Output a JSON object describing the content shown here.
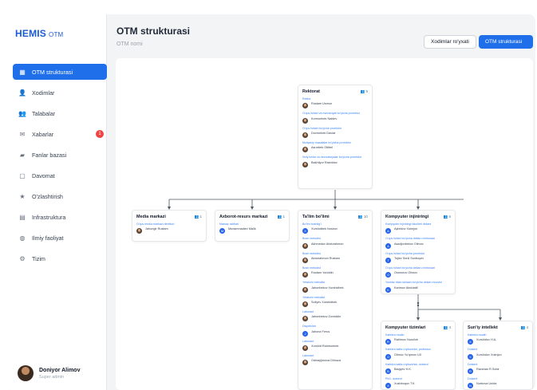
{
  "app": {
    "brand": "HEMIS",
    "brand_sub": "OTM"
  },
  "sidebar": {
    "items": [
      {
        "label": "OTM strukturasi",
        "icon": "org-chart-icon",
        "active": true
      },
      {
        "label": "Xodimlar",
        "icon": "person-icon"
      },
      {
        "label": "Talabalar",
        "icon": "group-icon"
      },
      {
        "label": "Xabarlar",
        "icon": "mail-icon",
        "badge": "1"
      },
      {
        "label": "Fanlar bazasi",
        "icon": "folder-icon"
      },
      {
        "label": "Davomat",
        "icon": "calendar-icon"
      },
      {
        "label": "O'zlashtirish",
        "icon": "star-icon"
      },
      {
        "label": "Infrastruktura",
        "icon": "building-icon"
      },
      {
        "label": "Ilmiy faoliyat",
        "icon": "globe-icon"
      },
      {
        "label": "Tizim",
        "icon": "gear-icon"
      }
    ]
  },
  "user": {
    "name": "Doniyor Alimov",
    "role": "Super admin"
  },
  "header": {
    "title": "OTM strukturasi",
    "subtitle": "OTM nomi",
    "btn_staff": "Xodimlar ro'yxati",
    "btn_structure": "OTM strukturasi"
  },
  "colors": {
    "accent": "#1f6feb",
    "badge": "#ef4444"
  },
  "org": {
    "rektorat": {
      "title": "Rektorat",
      "count": "5",
      "entries": [
        {
          "position": "Rektor",
          "name": "Rustam Usmon"
        },
        {
          "position": "O'quv ishlari va ma'naviyat bo'yicha prorektor",
          "name": "Komronbek Nabiev"
        },
        {
          "position": "O'quv ishlari bo'yicha prorektor",
          "name": "Dovronbek Davlat"
        },
        {
          "position": "Moliyaviy masalalar bo'yicha prorektor",
          "name": "Asrorbek Oltibel"
        },
        {
          "position": "Ilmiy ishlar va innovatsiyalar bo'yicha prorektor",
          "name": "Bakhtiyor Rashidov"
        }
      ]
    },
    "media": {
      "title": "Media markazi",
      "count": "1",
      "entries": [
        {
          "position": "O'quv media markazi direktori",
          "name": "Jahongir Rustam"
        }
      ]
    },
    "axborot": {
      "title": "Axborot-resurs markazi",
      "count": "1",
      "entries": [
        {
          "position": "Markaz rahbari",
          "name": "Muxammadiev Malik",
          "letter": "M"
        }
      ]
    },
    "talim": {
      "title": "Ta'lim bo'limi",
      "count": "10",
      "entries": [
        {
          "position": "Bo'lim boshlig'i",
          "name": "Xurshidbek Nosirov",
          "letter": "X"
        },
        {
          "position": "Bosh metodist",
          "name": "Akhmedov Abdurahmon"
        },
        {
          "position": "Bosh metodist",
          "name": "Abdurahmon Rustam"
        },
        {
          "position": "Bosh metodist",
          "name": "Rustam Yoriddin"
        },
        {
          "position": "Yetakchi metodist",
          "name": "Jahonbekov Xurshidbek"
        },
        {
          "position": "Yetakchi metodist",
          "name": "Soliyev Xurshidbek"
        },
        {
          "position": "Laborant",
          "name": "Jahonbekov Zuxriddin"
        },
        {
          "position": "Dispetcher",
          "name": "Jahona Ferus",
          "letter": "J"
        },
        {
          "position": "Laborant",
          "name": "Xurshid Rahmonbek"
        },
        {
          "position": "Laborant",
          "name": "Odinayjonova Dilnoza"
        }
      ]
    },
    "kompyuter": {
      "title": "Kompyuter injiniringi",
      "count": "6",
      "entries": [
        {
          "position": "Kompyuter injiniringi fakulteti dekani",
          "name": "Aybekov Xolmjon",
          "letter": "A"
        },
        {
          "position": "O'quv ishlari bo'yicha dekan o'rinbosari",
          "name": "Asadjonbekov Olimov",
          "letter": "A"
        },
        {
          "position": "O'quv ishlari bo'yicha prorektor",
          "name": "Tojiev Sonli Sonboyev",
          "letter": "T"
        },
        {
          "position": "O'quv ishlari bo'yicha dekan o'rinbosari",
          "name": "Osmonov Olimov",
          "letter": "O"
        },
        {
          "position": "Yoshlar bilan ishlash bo'yicha dekan muovini",
          "name": "Karimov Abdulatif",
          "letter": "K"
        }
      ]
    },
    "tizimlar": {
      "title": "Kompyuter tizimlari",
      "count": "4",
      "entries": [
        {
          "position": "Kafedra mudiri",
          "name": "Rahimov Nurulloh",
          "letter": "R"
        },
        {
          "position": "Kafedra katta o'qituvchisi, professor",
          "name": "Olimov Yo'qimov UX",
          "letter": "O"
        },
        {
          "position": "Kafedra katta o'qituvchisi, dotsent",
          "name": "Baqiyev H.K.",
          "letter": "B"
        },
        {
          "position": "PhD, dotsent",
          "name": "Xushboqov T.K.",
          "letter": "X"
        }
      ]
    },
    "suniy": {
      "title": "Sun'iy intellekt",
      "count": "4",
      "entries": [
        {
          "position": "Kafedra mudiri",
          "name": "Xurshidov H.A.",
          "letter": "X"
        },
        {
          "position": "Dotsent",
          "name": "Xurshidov Xolmjon",
          "letter": "X"
        },
        {
          "position": "Dotsent",
          "name": "Ravshan R.Sobir",
          "letter": "R"
        },
        {
          "position": "Dotsent",
          "name": "Nurbova Unida",
          "letter": "N"
        }
      ]
    }
  }
}
